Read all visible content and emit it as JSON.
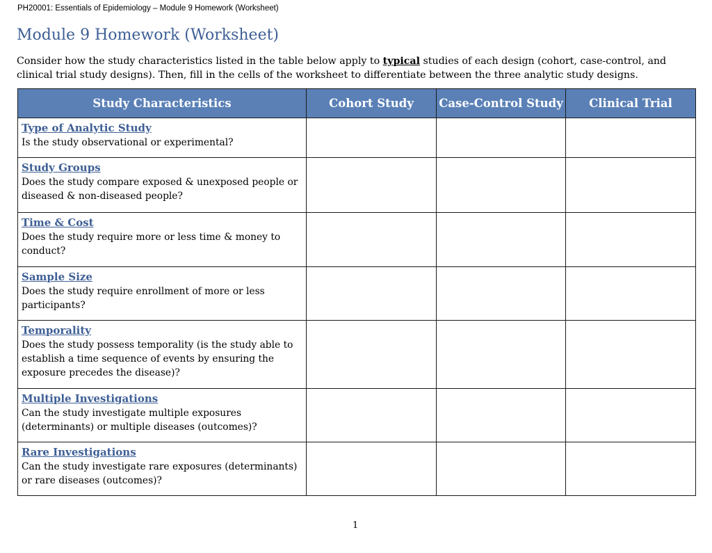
{
  "document": {
    "running_header": "PH20001: Essentials of Epidemiology – Module 9 Homework (Worksheet)",
    "title": "Module 9 Homework (Worksheet)",
    "intro": {
      "before_emphasis": "Consider how the study characteristics listed in the table below apply to ",
      "emphasis": "typical",
      "after_emphasis": " studies of each design (cohort, case-control, and clinical trial study designs). Then, fill in the cells of the worksheet to differentiate between the three analytic study designs."
    },
    "page_number": "1"
  },
  "colors": {
    "header_fill": "#5a80b6",
    "heading_text": "#3e5f95"
  },
  "table": {
    "headers": [
      "Study Characteristics",
      "Cohort Study",
      "Case-Control Study",
      "Clinical Trial"
    ],
    "rows": [
      {
        "title": "Type of Analytic Study",
        "question": "Is the study observational or experimental?",
        "cohort": "",
        "case_control": "",
        "clinical_trial": ""
      },
      {
        "title": "Study Groups",
        "question": "Does the study compare exposed & unexposed people or diseased & non-diseased people?",
        "cohort": "",
        "case_control": "",
        "clinical_trial": ""
      },
      {
        "title": "Time & Cost",
        "question": "Does the study require more or less time & money to conduct?",
        "cohort": "",
        "case_control": "",
        "clinical_trial": ""
      },
      {
        "title": "Sample Size",
        "question": "Does the study require enrollment of more or less participants?",
        "cohort": "",
        "case_control": "",
        "clinical_trial": ""
      },
      {
        "title": "Temporality",
        "question": "Does the study possess temporality (is the study able to establish a time sequence of events by ensuring the exposure precedes the disease)?",
        "cohort": "",
        "case_control": "",
        "clinical_trial": ""
      },
      {
        "title": "Multiple Investigations",
        "question": "Can the study investigate multiple exposures (determinants) or multiple diseases (outcomes)?",
        "cohort": "",
        "case_control": "",
        "clinical_trial": ""
      },
      {
        "title": "Rare Investigations",
        "question": "Can the study investigate rare exposures (determinants) or rare diseases (outcomes)?",
        "cohort": "",
        "case_control": "",
        "clinical_trial": ""
      }
    ]
  }
}
